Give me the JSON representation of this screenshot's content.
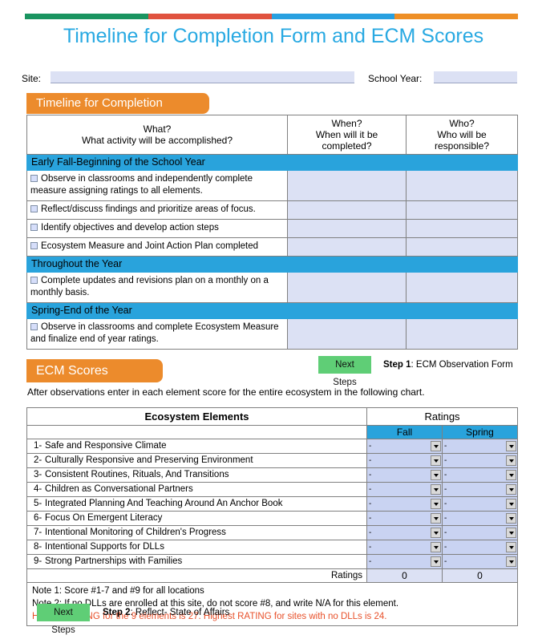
{
  "header": {
    "title": "Timeline for Completion Form and ECM Scores",
    "bar_colors": [
      "#1a9460",
      "#e0523f",
      "#28a0e0",
      "#ee8f26"
    ],
    "title_color": "#28a9e2"
  },
  "form_fields": {
    "site_label": "Site:",
    "site_value": "",
    "site_placeholder": "",
    "school_year_label": "School Year:",
    "school_year_value": "",
    "school_year_placeholder": ""
  },
  "timeline": {
    "banner": "Timeline for Completion",
    "columns": [
      {
        "line1": "What?",
        "line2": "What activity will be accomplished?"
      },
      {
        "line1": "When?",
        "line2": "When will it be",
        "line3": "completed?"
      },
      {
        "line1": "Who?",
        "line2": "Who will be",
        "line3": "responsible?"
      }
    ],
    "sections": [
      {
        "title": "Early Fall-Beginning of the School Year",
        "tasks": [
          {
            "text": "Observe in classrooms and independently complete measure assigning ratings to all elements.",
            "when": "",
            "who": ""
          },
          {
            "text": "Reflect/discuss findings and prioritize areas of focus.",
            "when": "",
            "who": ""
          },
          {
            "text": "Identify objectives and develop action steps",
            "when": "",
            "who": ""
          },
          {
            "text": "Ecosystem Measure and Joint Action Plan completed",
            "when": "",
            "who": ""
          }
        ]
      },
      {
        "title": "Throughout the Year",
        "tasks": [
          {
            "text": "Complete updates and revisions  plan on a monthly on a monthly basis.",
            "when": "",
            "who": ""
          }
        ]
      },
      {
        "title": "Spring-End of the Year",
        "tasks": [
          {
            "text": "Observe in classrooms and complete Ecosystem Measure and finalize end of year ratings.",
            "when": "",
            "who": ""
          }
        ]
      }
    ]
  },
  "step1": {
    "button_label": "Next Steps",
    "step_prefix": "Step 1",
    "step_text": ": ECM Observation Form"
  },
  "ecm": {
    "banner": "ECM Scores",
    "intro": "After observations enter in each element score for the entire ecosystem in the following chart.",
    "header_elements": "Ecosystem Elements",
    "header_ratings": "Ratings",
    "season_fall": "Fall",
    "season_spring": "Spring",
    "elements": [
      {
        "num": "1-",
        "name": "Safe and Responsive Climate",
        "fall": "-",
        "spring": "-"
      },
      {
        "num": "2-",
        "name": "Culturally Responsive and Preserving Environment",
        "fall": "-",
        "spring": "-"
      },
      {
        "num": "3-",
        "name": "Consistent Routines, Rituals, And Transitions",
        "fall": "-",
        "spring": "-"
      },
      {
        "num": "4-",
        "name": "Children  as  Conversational  Partners",
        "fall": "-",
        "spring": "-"
      },
      {
        "num": "5-",
        "name": "Integrated Planning And Teaching Around An Anchor Book",
        "fall": "-",
        "spring": "-"
      },
      {
        "num": "6-",
        "name": "Focus On Emergent Literacy",
        "fall": "-",
        "spring": "-"
      },
      {
        "num": "7-",
        "name": "Intentional Monitoring of Children's Progress",
        "fall": "-",
        "spring": "-"
      },
      {
        "num": "8-",
        "name": "Intentional Supports for DLLs",
        "fall": "-",
        "spring": "-"
      },
      {
        "num": "9-",
        "name": "Strong Partnerships with Families",
        "fall": "-",
        "spring": "-"
      }
    ],
    "totals_label": "Ratings",
    "total_fall": "0",
    "total_spring": "0",
    "note1": "Note 1: Score #1-7 and #9 for all locations",
    "note2": "Note 2: If no DLLs are enrolled at this site, do not score #8, and write N/A for this element.",
    "note3": "Highest RATING for the 9 elements is 27. Highest RATING for sites with no DLLs is 24."
  },
  "step2": {
    "button_label": "Next Steps",
    "step_prefix": "Step 2",
    "step_text": ": Reflect- State of Affairs"
  }
}
